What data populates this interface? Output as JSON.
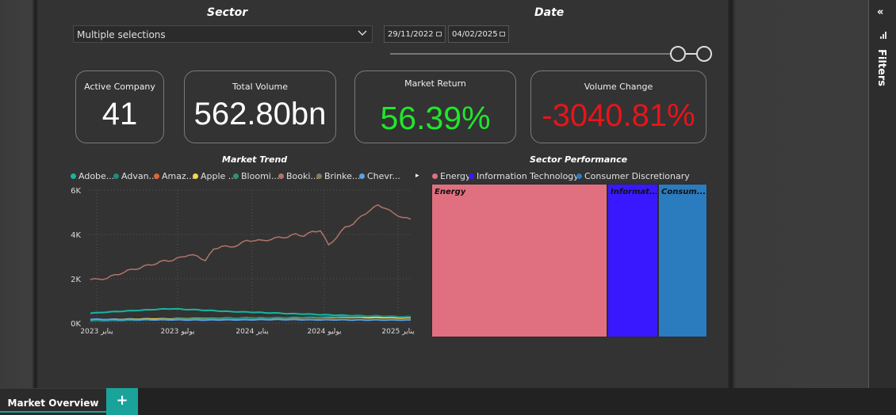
{
  "filters": {
    "sector": {
      "title": "Sector",
      "selected": "Multiple selections"
    },
    "date": {
      "title": "Date",
      "start": "29/11/2022",
      "end": "04/02/2025"
    }
  },
  "filters_pane": {
    "label": "Filters",
    "collapse_glyph": "«"
  },
  "cards": {
    "active_company": {
      "label": "Active Company",
      "value": "41"
    },
    "total_volume": {
      "label": "Total Volume",
      "value": "562.80bn"
    },
    "market_return": {
      "label": "Market Return",
      "value": "56.39%",
      "color": "#21e62b"
    },
    "volume_change": {
      "label": "Volume Change",
      "value": "-3040.81%",
      "color": "#e8141a"
    }
  },
  "market_trend": {
    "title": "Market Trend",
    "legend_next_glyph": "▸",
    "legend": [
      {
        "name": "Adobe...",
        "color": "#17b5a0"
      },
      {
        "name": "Advan...",
        "color": "#1f8a7e"
      },
      {
        "name": "Amaz...",
        "color": "#e0643a"
      },
      {
        "name": "Apple ...",
        "color": "#f5d94a"
      },
      {
        "name": "Bloomi...",
        "color": "#2e8f7a"
      },
      {
        "name": "Booki...",
        "color": "#b07568"
      },
      {
        "name": "Brinke...",
        "color": "#8a7a5a"
      },
      {
        "name": "Chevr...",
        "color": "#5aa0e6"
      }
    ]
  },
  "chart_data": {
    "type": "line",
    "title": "Market Trend",
    "ylim": [
      0,
      6000
    ],
    "yticks": [
      "0K",
      "2K",
      "4K",
      "6K"
    ],
    "xticks": [
      "يناير 2023",
      "يوليو 2023",
      "يناير 2024",
      "يوليو 2024",
      "يناير 2025"
    ],
    "grid": true,
    "legend_placement": "top",
    "series": [
      {
        "name": "Booki...",
        "color": "#b07568",
        "values": [
          2000,
          1950,
          2050,
          2150,
          2300,
          2400,
          2500,
          2600,
          2700,
          2800,
          2850,
          2950,
          3100,
          3000,
          2850,
          3300,
          3500,
          3400,
          3550,
          3700,
          3750,
          3700,
          3800,
          3850,
          3900,
          4000,
          3950,
          4100,
          4200,
          3500,
          3900,
          4300,
          4500,
          4800,
          5100,
          5300,
          5200,
          4900,
          4800,
          4650
        ]
      },
      {
        "name": "Adobe...",
        "color": "#17b5a0",
        "values": [
          450,
          470,
          500,
          520,
          540,
          560,
          580,
          600,
          620,
          640,
          650,
          630,
          610,
          600,
          580,
          560,
          540,
          520,
          510,
          500,
          490,
          470,
          460,
          450,
          430,
          420,
          410,
          400,
          380,
          370,
          360,
          350,
          340,
          330,
          320,
          320,
          310,
          300,
          290,
          280
        ]
      },
      {
        "name": "Apple ...",
        "color": "#f5d94a",
        "values": [
          150,
          150,
          160,
          170,
          170,
          180,
          180,
          190,
          190,
          190,
          190,
          200,
          200,
          210,
          210,
          210,
          220,
          220,
          220,
          230,
          230,
          230,
          230,
          240,
          240,
          240,
          250,
          250,
          250,
          250,
          260,
          260,
          260,
          260,
          250,
          250,
          250,
          240,
          240,
          240
        ]
      },
      {
        "name": "Advan...",
        "color": "#1f8a7e",
        "values": [
          100,
          105,
          110,
          115,
          120,
          130,
          140,
          150,
          150,
          160,
          170,
          180,
          180,
          190,
          190,
          200,
          200,
          210,
          220,
          220,
          230,
          230,
          240,
          250,
          250,
          260,
          260,
          270,
          270,
          280,
          290,
          300,
          300,
          310,
          320,
          320,
          310,
          300,
          290,
          280
        ]
      },
      {
        "name": "Chevr...",
        "color": "#5aa0e6",
        "values": [
          170,
          170,
          165,
          160,
          160,
          160,
          155,
          155,
          150,
          150,
          150,
          150,
          145,
          145,
          145,
          145,
          150,
          150,
          150,
          150,
          155,
          155,
          160,
          160,
          160,
          155,
          155,
          150,
          150,
          150,
          150,
          150,
          145,
          145,
          145,
          145,
          145,
          140,
          140,
          140
        ]
      }
    ]
  },
  "sector_performance": {
    "title": "Sector Performance",
    "legend": [
      {
        "name": "Energy",
        "color": "#e07080"
      },
      {
        "name": "Information Technology",
        "color": "#3a18ff"
      },
      {
        "name": "Consumer Discretionary",
        "color": "#2b7bbf"
      }
    ],
    "tiles": [
      {
        "label": "Energy",
        "value": 63.8,
        "color": "#e07080"
      },
      {
        "label": "Informat...",
        "value": 18.4,
        "color": "#3a18ff"
      },
      {
        "label": "Consum...",
        "value": 17.8,
        "color": "#2b7bbf"
      }
    ]
  },
  "tabs": {
    "active": "Market Overview",
    "add_glyph": "+"
  }
}
